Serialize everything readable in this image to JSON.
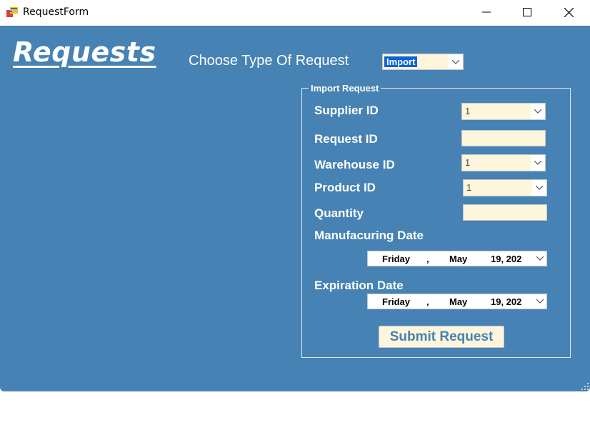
{
  "window": {
    "title": "RequestForm"
  },
  "header": {
    "title": "Requests"
  },
  "request_type": {
    "label": "Choose Type Of Request",
    "selected": "Import"
  },
  "group": {
    "title": "Import Request"
  },
  "fields": {
    "supplier_id": {
      "label": "Supplier ID",
      "value": "1"
    },
    "request_id": {
      "label": "Request ID",
      "value": ""
    },
    "warehouse_id": {
      "label": "Warehouse ID",
      "value": "1"
    },
    "product_id": {
      "label": "Product ID",
      "value": "1"
    },
    "quantity": {
      "label": "Quantity",
      "value": ""
    },
    "manufacturing_date": {
      "label": "Manufacuring Date",
      "day": "Friday",
      "sep": ",",
      "month": "May",
      "date": "19, 202"
    },
    "expiration_date": {
      "label": "Expiration Date",
      "day": "Friday",
      "sep": ",",
      "month": "May",
      "date": "19, 202"
    }
  },
  "submit_label": "Submit Request",
  "colors": {
    "background": "#4682b4",
    "input": "#fdf5dc",
    "text": "#ffffff"
  }
}
